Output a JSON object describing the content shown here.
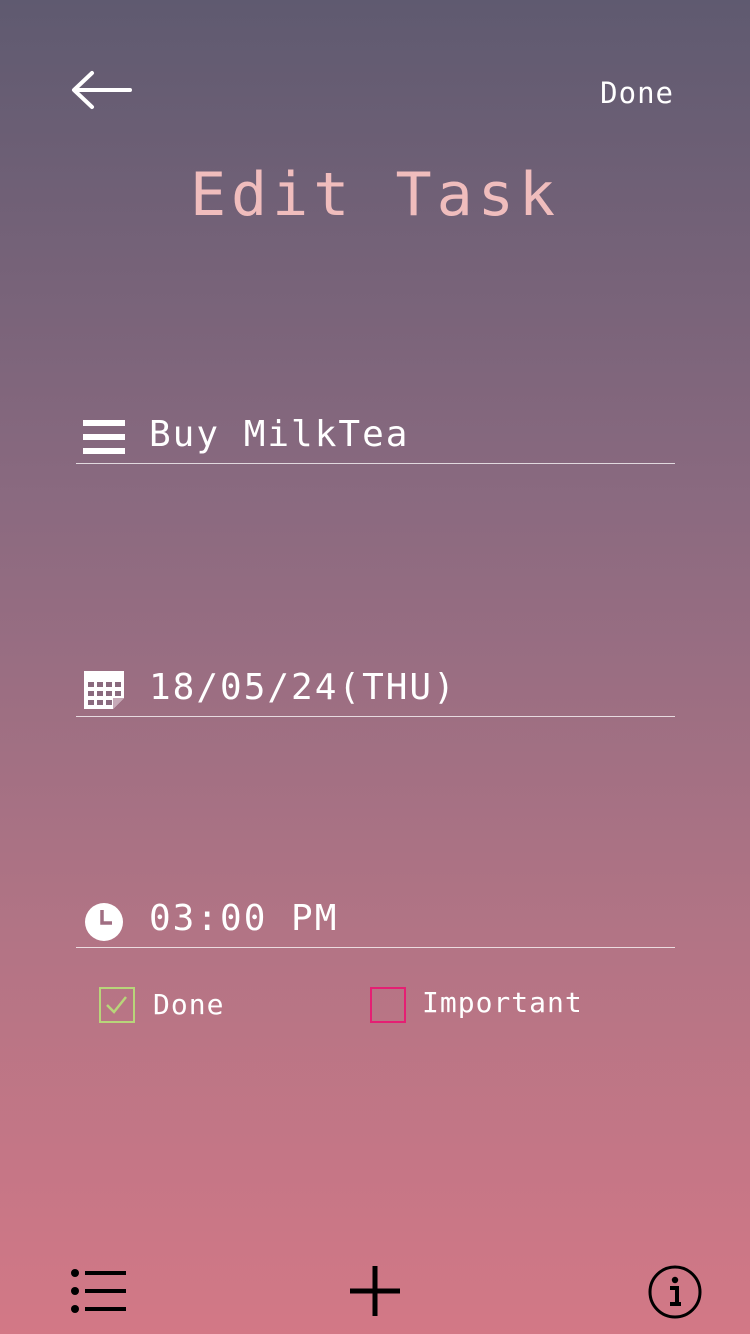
{
  "header": {
    "title": "Edit Task",
    "done_label": "Done"
  },
  "fields": {
    "task": {
      "value": "Buy MilkTea",
      "icon": "menu-lines-icon"
    },
    "date": {
      "value": "18/05/24(THU)",
      "icon": "calendar-icon"
    },
    "time": {
      "value": "03:00 PM",
      "icon": "clock-icon"
    }
  },
  "checkboxes": {
    "done": {
      "label": "Done",
      "checked": true,
      "color": "#b8d57a"
    },
    "important": {
      "label": "Important",
      "checked": false,
      "color": "#e51f73"
    }
  },
  "colors": {
    "title": "#f0bdbd",
    "gradient_top": "#5f5a70",
    "gradient_bottom": "#d37886"
  },
  "bottom_bar": {
    "icons": [
      "list-icon",
      "plus-icon",
      "info-icon"
    ]
  }
}
